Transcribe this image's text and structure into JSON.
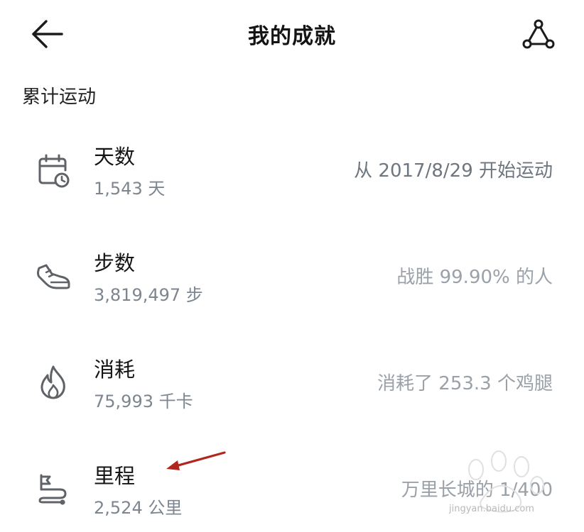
{
  "header": {
    "title": "我的成就",
    "back_icon": "arrow-left-icon",
    "share_icon": "share-icon"
  },
  "section": {
    "title": "累计运动"
  },
  "rows": [
    {
      "label": "天数",
      "value": "1,543 天",
      "desc": "从 2017/8/29 开始运动",
      "icon": "calendar-clock-icon"
    },
    {
      "label": "步数",
      "value": "3,819,497 步",
      "desc": "战胜 99.90% 的人",
      "icon": "sneaker-icon"
    },
    {
      "label": "消耗",
      "value": "75,993 千卡",
      "desc": "消耗了 253.3 个鸡腿",
      "icon": "flame-icon"
    },
    {
      "label": "里程",
      "value": "2,524 公里",
      "desc": "万里长城的 1/400",
      "icon": "route-flag-icon"
    }
  ],
  "annotation": {
    "arrow_color": "#b3261e"
  },
  "watermark": {
    "text": "jingyan.baidu.com"
  },
  "colors": {
    "text_primary": "#151515",
    "text_secondary": "#7d8690",
    "icon_gray": "#5f6368"
  }
}
